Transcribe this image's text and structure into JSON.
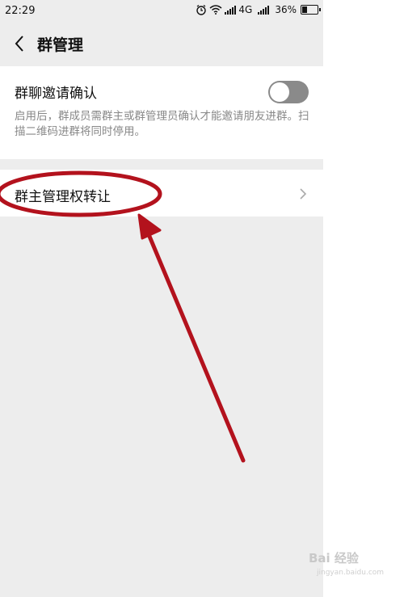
{
  "status_bar": {
    "time": "22:29",
    "network": "4G",
    "battery": "36%",
    "battery_level": 0.36
  },
  "header": {
    "title": "群管理",
    "back_icon": "chevron-left-icon"
  },
  "settings": {
    "invite_confirm": {
      "label": "群聊邀请确认",
      "description": "启用后，群成员需群主或群管理员确认才能邀请朋友进群。扫描二维码进群将同时停用。",
      "enabled": false
    },
    "transfer": {
      "label": "群主管理权转让",
      "chevron_icon": "chevron-right-icon"
    }
  },
  "colors": {
    "annotation": "#b3121d",
    "background": "#ededed",
    "card": "#ffffff",
    "toggle_off": "#8a8a8a"
  },
  "watermark": {
    "text": "Bai 经验",
    "sub": "jingyan.baidu.com"
  }
}
